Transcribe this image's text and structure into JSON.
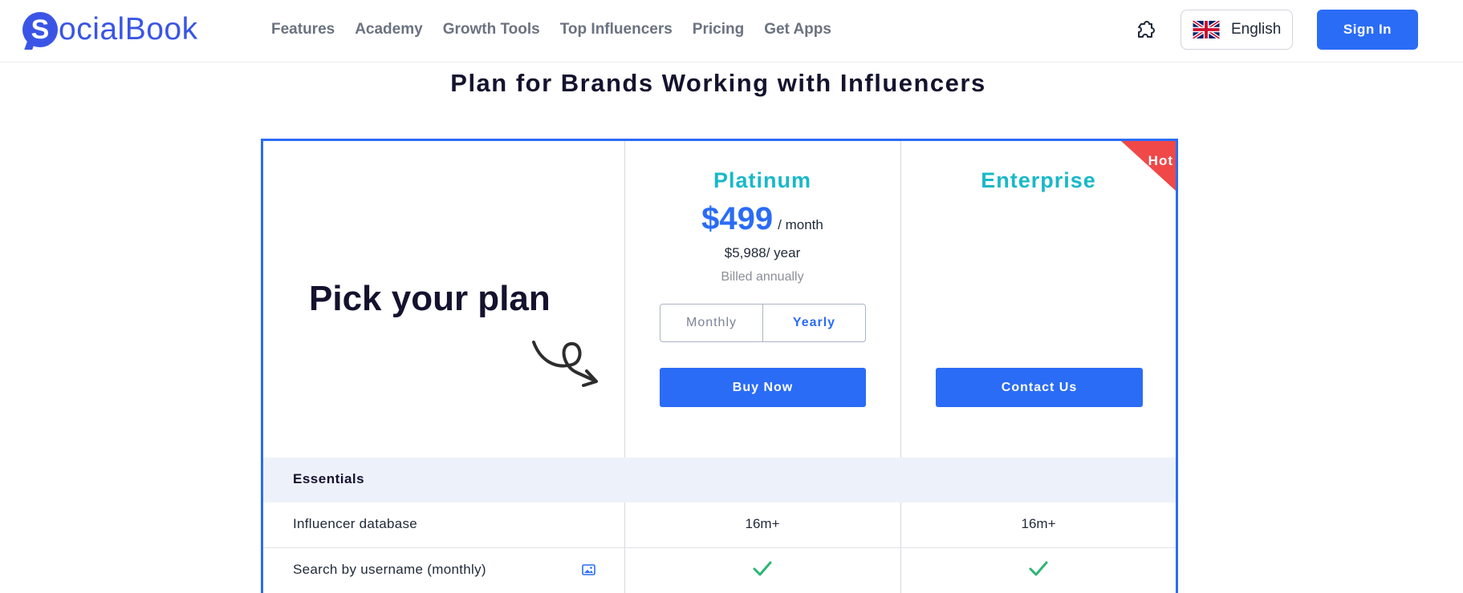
{
  "header": {
    "logo_letter": "S",
    "logo_text": "ocialBook",
    "nav": [
      "Features",
      "Academy",
      "Growth Tools",
      "Top Influencers",
      "Pricing",
      "Get Apps"
    ],
    "language": "English",
    "sign_in": "Sign In"
  },
  "page_title": "Plan for Brands Working with Influencers",
  "pricing": {
    "pick_plan": "Pick your plan",
    "plans": [
      {
        "name": "Platinum",
        "price": "$499",
        "per": "/ month",
        "year_price": "$5,988/ year",
        "billed": "Billed annually",
        "toggle": [
          "Monthly",
          "Yearly"
        ],
        "selected_toggle": "Yearly",
        "button": "Buy Now"
      },
      {
        "name": "Enterprise",
        "badge": "Hot",
        "button": "Contact Us"
      }
    ],
    "section": "Essentials",
    "rows": [
      {
        "label": "Influencer database",
        "platinum": "16m+",
        "enterprise": "16m+"
      },
      {
        "label": "Search by username (monthly)",
        "platinum": "check",
        "enterprise": "check"
      }
    ]
  },
  "colors": {
    "primary": "#2b6cf6",
    "teal": "#19b8c9",
    "hot": "#f04848",
    "check": "#2bb673"
  }
}
